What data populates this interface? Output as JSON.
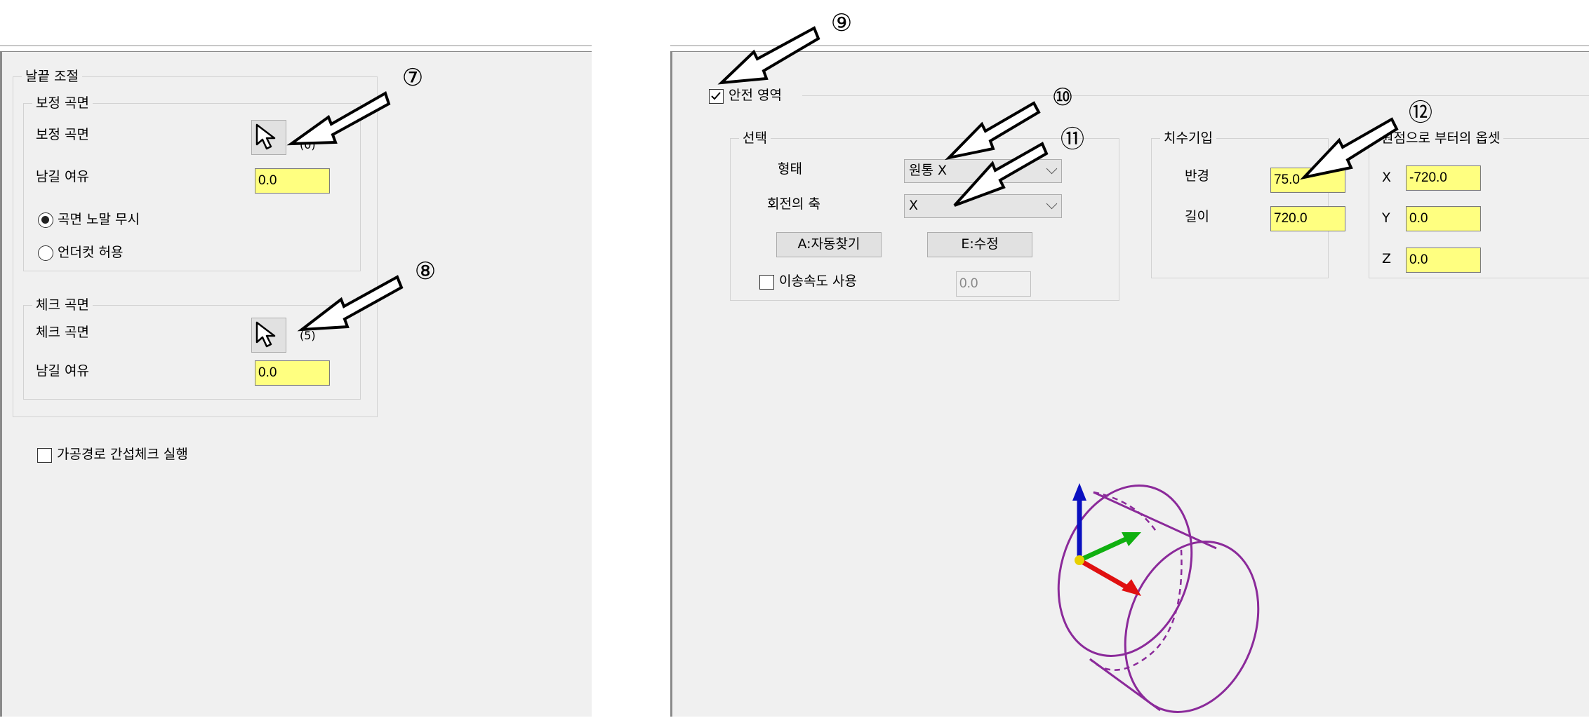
{
  "left": {
    "group_title": "날끝 조절",
    "correction": {
      "title": "보정 곡면",
      "surface_label": "보정 곡면",
      "count": "(0)",
      "stock_label": "남길 여유",
      "stock_value": "0.0",
      "radio_ignore": "곡면 노말 무시",
      "radio_undercut": "언더컷 허용",
      "radio_selected": "곡면 노말 무시"
    },
    "check": {
      "title": "체크 곡면",
      "surface_label": "체크 곡면",
      "count": "(5)",
      "stock_label": "남길 여유",
      "stock_value": "0.0"
    },
    "interference_check": {
      "label": "가공경로 간섭체크 실행",
      "checked": false
    }
  },
  "right": {
    "safe_area": {
      "label": "안전 영역",
      "checked": true
    },
    "selection": {
      "title": "선택",
      "shape_label": "형태",
      "shape_value": "원통 X",
      "axis_label": "회전의 축",
      "axis_value": "X",
      "auto_button": "A:자동찾기",
      "edit_button": "E:수정",
      "feed_label": "이송속도 사용",
      "feed_checked": false,
      "feed_value": "0.0"
    },
    "dimensions": {
      "title": "치수기입",
      "radius_label": "반경",
      "radius_value": "75.0",
      "length_label": "길이",
      "length_value": "720.0"
    },
    "offset": {
      "title": "원점으로 부터의 옵셋",
      "x_label": "X",
      "x_value": "-720.0",
      "y_label": "Y",
      "y_value": "0.0",
      "z_label": "Z",
      "z_value": "0.0"
    }
  },
  "callouts": {
    "c7": "⑦",
    "c8": "⑧",
    "c9": "⑨",
    "c10": "⑩",
    "c11": "⑪",
    "c12": "⑫"
  },
  "colors": {
    "field_bg": "#ffff80",
    "cylinder": "#8b2a9a",
    "axis_x": "#e01010",
    "axis_y": "#10b010",
    "axis_z": "#0a10c0"
  }
}
